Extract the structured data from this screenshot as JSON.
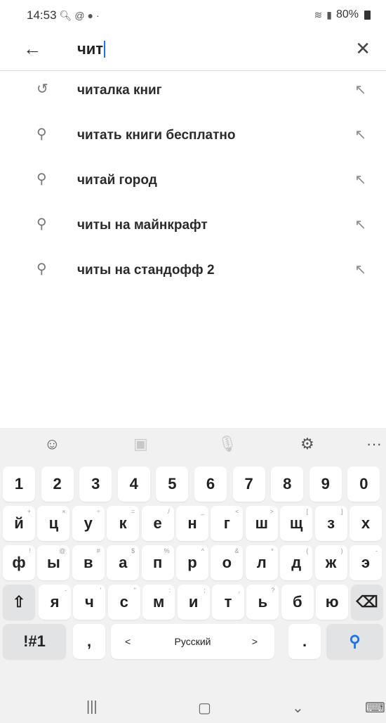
{
  "status": {
    "time": "14:53",
    "battery": "80%"
  },
  "search": {
    "back_icon": "arrow-left-icon",
    "query": "чит",
    "clear_icon": "close-icon"
  },
  "suggestions": [
    {
      "label": "читалка книг",
      "icon": "history-icon"
    },
    {
      "label": "читать книги бесплатно",
      "icon": "search-icon"
    },
    {
      "label": "читай город",
      "icon": "search-icon"
    },
    {
      "label": "читы на майнкрафт",
      "icon": "search-icon"
    },
    {
      "label": "читы на стандофф 2",
      "icon": "search-icon"
    }
  ],
  "keyboard": {
    "numbers": [
      "1",
      "2",
      "3",
      "4",
      "5",
      "6",
      "7",
      "8",
      "9",
      "0"
    ],
    "row1": [
      "й",
      "ц",
      "у",
      "к",
      "е",
      "н",
      "г",
      "ш",
      "щ",
      "з",
      "х"
    ],
    "row1_hints": [
      "+",
      "×",
      "÷",
      "=",
      "/",
      "_",
      "<",
      ">",
      "[",
      "]",
      ""
    ],
    "row2": [
      "ф",
      "ы",
      "в",
      "а",
      "п",
      "р",
      "о",
      "л",
      "д",
      "ж",
      "э"
    ],
    "row2_hints": [
      "!",
      "@",
      "#",
      "$",
      "%",
      "^",
      "&",
      "*",
      "(",
      ")",
      "-"
    ],
    "row3": [
      "я",
      "ч",
      "с",
      "м",
      "и",
      "т",
      "ь",
      "б",
      "ю"
    ],
    "row3_hints": [
      "-",
      "'",
      "\"",
      ":",
      ";",
      ",",
      "?",
      "",
      ""
    ],
    "symbols_label": "!#1",
    "comma": ",",
    "space_label": "Русский",
    "space_left": "<",
    "space_right": ">",
    "period": "."
  },
  "colors": {
    "accent": "#1a73e8",
    "keyboard_bg": "#f1f1f1",
    "key_bg": "#ffffff"
  }
}
